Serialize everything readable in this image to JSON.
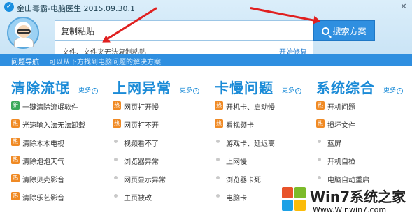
{
  "app": {
    "title": "金山毒霸-电脑医生 2015.09.30.1",
    "logo_icon": "kingsoft-logo-icon",
    "window_buttons": [
      "−",
      "×"
    ]
  },
  "search": {
    "value": "复制粘贴",
    "button_label": "搜索方案",
    "suggestion": "文件、文件夹无法复制粘贴",
    "suggestion_action": "开始修复"
  },
  "nav": {
    "title": "问题导航",
    "description": "可以从下方找到电脑问题的解决方案"
  },
  "columns": [
    {
      "title": "清除流氓",
      "more": "更多",
      "items": [
        {
          "tag": "新",
          "type": "new",
          "label": "一键清除流氓软件"
        },
        {
          "tag": "热",
          "type": "hot",
          "label": "光速输入法无法卸载"
        },
        {
          "tag": "热",
          "type": "hot",
          "label": "清除木木电视"
        },
        {
          "tag": "热",
          "type": "hot",
          "label": "清除泡泡天气"
        },
        {
          "tag": "热",
          "type": "hot",
          "label": "清除贝壳影音"
        },
        {
          "tag": "热",
          "type": "hot",
          "label": "清除乐艺影音"
        }
      ]
    },
    {
      "title": "上网异常",
      "more": "更多",
      "items": [
        {
          "tag": "热",
          "type": "hot",
          "label": "网页打开慢"
        },
        {
          "tag": "热",
          "type": "hot",
          "label": "网页打不开"
        },
        {
          "tag": "",
          "type": "dot",
          "label": "视频看不了"
        },
        {
          "tag": "",
          "type": "dot",
          "label": "浏览器异常"
        },
        {
          "tag": "",
          "type": "dot",
          "label": "网页显示异常"
        },
        {
          "tag": "",
          "type": "dot",
          "label": "主页被改"
        }
      ]
    },
    {
      "title": "卡慢问题",
      "more": "更多",
      "items": [
        {
          "tag": "热",
          "type": "hot",
          "label": "开机卡、启动慢"
        },
        {
          "tag": "热",
          "type": "hot",
          "label": "看视频卡"
        },
        {
          "tag": "",
          "type": "dot",
          "label": "游戏卡、延迟高"
        },
        {
          "tag": "",
          "type": "dot",
          "label": "上网慢"
        },
        {
          "tag": "",
          "type": "dot",
          "label": "浏览器卡死"
        },
        {
          "tag": "",
          "type": "dot",
          "label": "电脑卡"
        }
      ]
    },
    {
      "title": "系统综合",
      "more": "更多",
      "items": [
        {
          "tag": "热",
          "type": "hot",
          "label": "开机问题"
        },
        {
          "tag": "热",
          "type": "hot",
          "label": "损坏文件"
        },
        {
          "tag": "",
          "type": "dot",
          "label": "蓝屏"
        },
        {
          "tag": "",
          "type": "dot",
          "label": "开机自检"
        },
        {
          "tag": "",
          "type": "dot",
          "label": "电脑自动重启"
        },
        {
          "tag": "",
          "type": "dot",
          "label": ""
        }
      ]
    }
  ],
  "watermark": {
    "brand": "Win7系统之家",
    "url": "Www.Winwin7.com"
  },
  "colors": {
    "accent": "#1b8bd7",
    "nav_bar": "#2f8fe0",
    "hot_tag": "#f08a24",
    "new_tag": "#3aa85a",
    "annotation_arrow": "#e02020"
  }
}
